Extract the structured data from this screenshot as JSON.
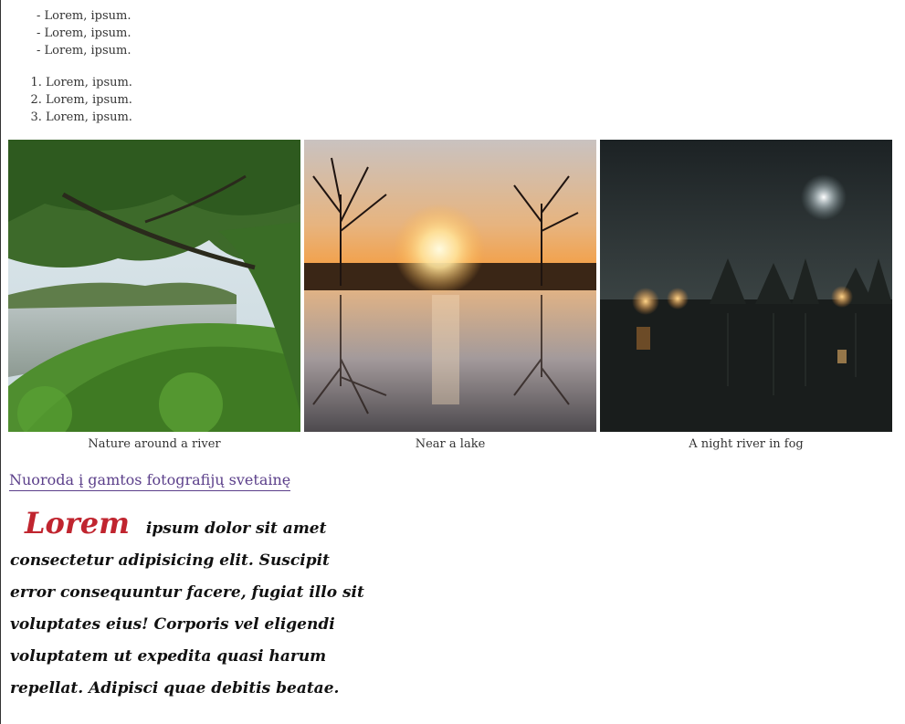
{
  "dash_list": [
    "Lorem, ipsum.",
    "Lorem, ipsum.",
    "Lorem, ipsum."
  ],
  "ordered_list": [
    "Lorem, ipsum.",
    "Lorem, ipsum.",
    "Lorem, ipsum."
  ],
  "gallery": [
    {
      "caption": "Nature around a river",
      "icon": "forest-river-photo"
    },
    {
      "caption": "Near a lake",
      "icon": "sunset-lake-photo"
    },
    {
      "caption": "A night river in fog",
      "icon": "night-fog-river-photo"
    }
  ],
  "link": {
    "text": "Nuoroda į gamtos fotografijų svetainę"
  },
  "paragraph": {
    "drop_word": "Lorem",
    "body": "ipsum dolor sit amet consectetur adipisicing elit. Suscipit error consequuntur facere, fugiat illo sit voluptates eius! Corporis vel eligendi voluptatem ut expedita quasi harum repellat. Adipisci quae debitis beatae."
  },
  "colors": {
    "link": "#5b3f8a",
    "drop": "#c0252f"
  }
}
